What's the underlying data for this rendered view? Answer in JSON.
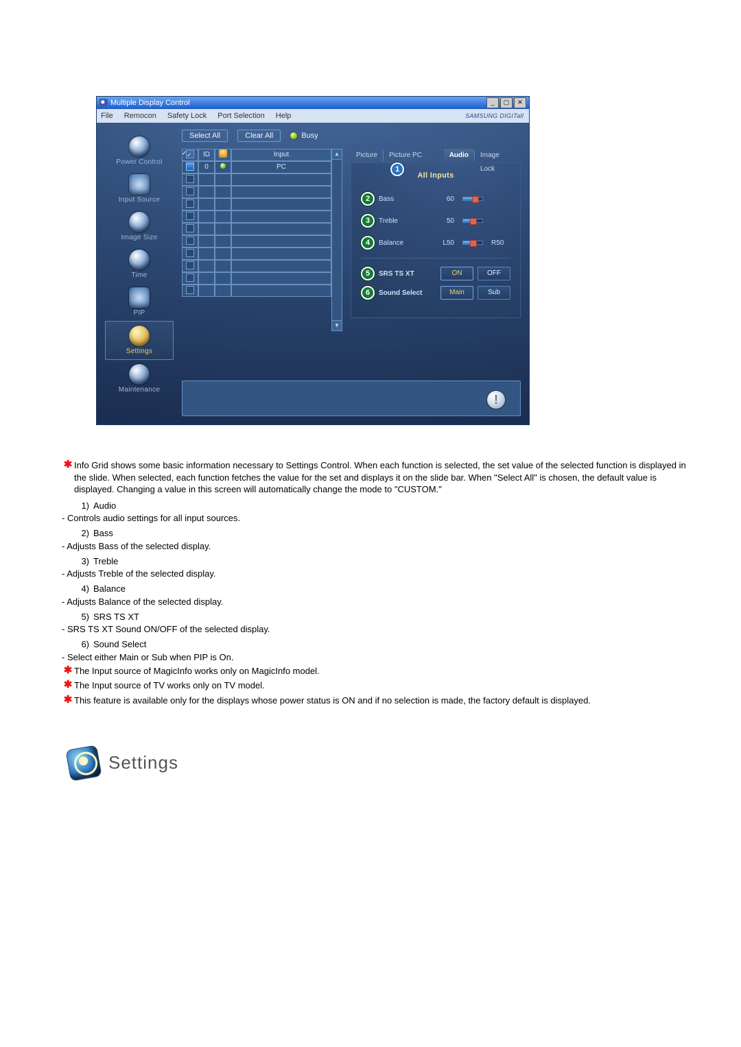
{
  "app_window": {
    "title": "Multiple Display Control",
    "brand": "SAMSUNG DIGITall",
    "menus": [
      "File",
      "Remocon",
      "Safety Lock",
      "Port Selection",
      "Help"
    ],
    "win_controls": {
      "min_glyph": "_",
      "max_glyph": "▢",
      "close_glyph": "✕"
    }
  },
  "toolbar": {
    "select_all": "Select All",
    "clear_all": "Clear All",
    "busy": "Busy"
  },
  "sidebar": {
    "items": [
      {
        "label": "Power Control"
      },
      {
        "label": "Input Source"
      },
      {
        "label": "Image Size"
      },
      {
        "label": "Time"
      },
      {
        "label": "PIP"
      },
      {
        "label": "Settings"
      },
      {
        "label": "Maintenance"
      }
    ],
    "active_index": 5
  },
  "grid": {
    "headers": {
      "chk": "",
      "id": "ID",
      "power": "",
      "input": "Input"
    },
    "rows": [
      {
        "id": "0",
        "input": "PC",
        "checked": true,
        "on": true
      }
    ],
    "empty_row_count": 10
  },
  "tabs": {
    "items": [
      "Picture",
      "Picture PC",
      "Audio",
      "Image Lock"
    ],
    "active_index": 2,
    "callout_number": "1"
  },
  "panel": {
    "title": "All Inputs",
    "sliders": [
      {
        "marker": "2",
        "label": "Bass",
        "value": "60",
        "percent": 60,
        "right_label": ""
      },
      {
        "marker": "3",
        "label": "Treble",
        "value": "50",
        "percent": 50,
        "right_label": ""
      },
      {
        "marker": "4",
        "label": "Balance",
        "value": "L50",
        "percent": 50,
        "right_label": "R50"
      }
    ],
    "options": [
      {
        "marker": "5",
        "label": "SRS TS XT",
        "a": "ON",
        "b": "OFF"
      },
      {
        "marker": "6",
        "label": "Sound Select",
        "a": "Main",
        "b": "Sub"
      }
    ],
    "warn_glyph": "!"
  },
  "doc": {
    "intro": "Info Grid shows some basic information necessary to Settings Control. When each function is selected, the set value of the selected function is displayed in the slide. When selected, each function fetches the value for the set and displays it on the slide bar. When \"Select All\" is chosen, the default value is displayed. Changing a value in this screen will automatically change the mode to \"CUSTOM.\"",
    "items": [
      {
        "num": "1)",
        "title": "Audio",
        "desc": "- Controls audio settings for all input sources."
      },
      {
        "num": "2)",
        "title": "Bass",
        "desc": "- Adjusts Bass of the selected display."
      },
      {
        "num": "3)",
        "title": "Treble",
        "desc": "- Adjusts Treble of the selected display."
      },
      {
        "num": "4)",
        "title": "Balance",
        "desc": "- Adjusts Balance of the selected display."
      },
      {
        "num": "5)",
        "title": "SRS TS XT",
        "desc": "- SRS TS XT Sound ON/OFF of the selected display."
      },
      {
        "num": "6)",
        "title": "Sound Select",
        "desc": "- Select either Main or Sub when PIP is On."
      }
    ],
    "notes": [
      "The Input source of MagicInfo works only on MagicInfo model.",
      "The Input source of TV works only on TV model.",
      "This feature is available only for the displays whose power status is ON and if no selection is made, the factory default is displayed."
    ],
    "heading": "Settings"
  }
}
